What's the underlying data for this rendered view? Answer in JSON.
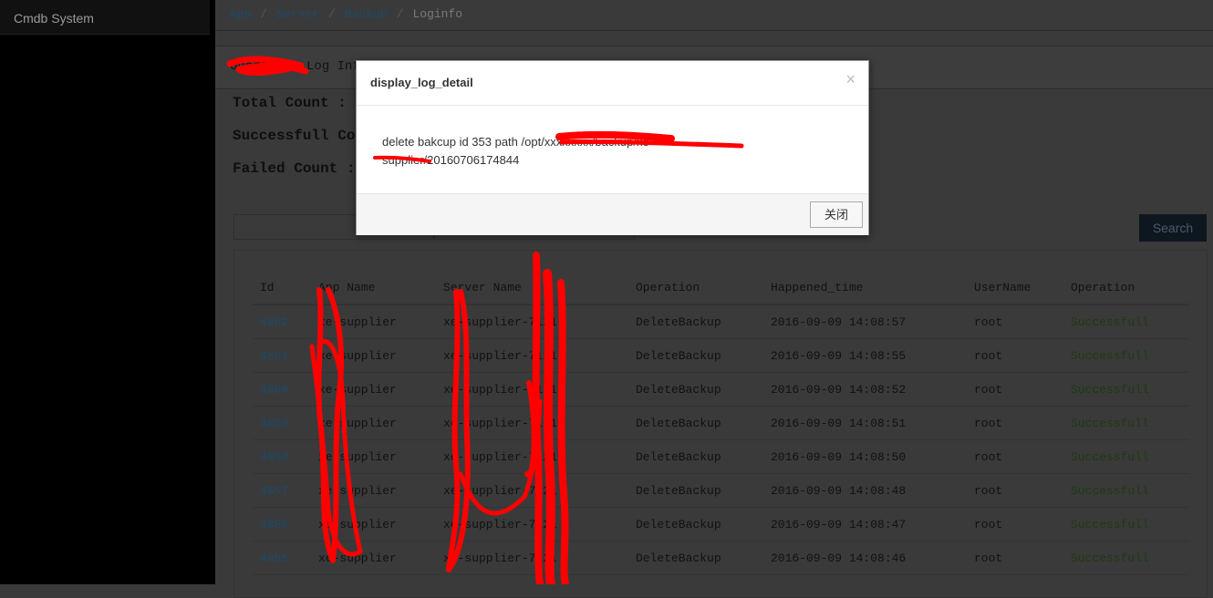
{
  "sidebar": {
    "brand": "Cmdb System"
  },
  "breadcrumb": {
    "items": [
      "App",
      "Server",
      "Backup"
    ],
    "active": "Loginfo"
  },
  "panel": {
    "title": "Operation Log Info"
  },
  "stats": {
    "total_label": "Total Count :",
    "success_label": "Successfull Count :",
    "failed_label": "Failed Count :"
  },
  "search": {
    "button_label": "Search"
  },
  "table": {
    "headers": [
      "Id",
      "App Name",
      "Server Name",
      "Operation",
      "Happened_time",
      "UserName",
      "Operation"
    ],
    "rows": [
      {
        "id": "4862",
        "app": "xe-supplier",
        "server": "xe-supplier-7121",
        "operation": "DeleteBackup",
        "time": "2016-09-09 14:08:57",
        "user": "root",
        "status": "Successfull"
      },
      {
        "id": "4861",
        "app": "xe-supplier",
        "server": "xe-supplier-7121",
        "operation": "DeleteBackup",
        "time": "2016-09-09 14:08:55",
        "user": "root",
        "status": "Successfull"
      },
      {
        "id": "4860",
        "app": "xe-supplier",
        "server": "xe-supplier-7121",
        "operation": "DeleteBackup",
        "time": "2016-09-09 14:08:52",
        "user": "root",
        "status": "Successfull"
      },
      {
        "id": "4859",
        "app": "xe-supplier",
        "server": "xe-supplier-7121",
        "operation": "DeleteBackup",
        "time": "2016-09-09 14:08:51",
        "user": "root",
        "status": "Successfull"
      },
      {
        "id": "4858",
        "app": "xe-supplier",
        "server": "xe-supplier-7121",
        "operation": "DeleteBackup",
        "time": "2016-09-09 14:08:50",
        "user": "root",
        "status": "Successfull"
      },
      {
        "id": "4857",
        "app": "xe-supplier",
        "server": "xe-supplier-7121",
        "operation": "DeleteBackup",
        "time": "2016-09-09 14:08:48",
        "user": "root",
        "status": "Successfull"
      },
      {
        "id": "4856",
        "app": "xe-supplier",
        "server": "xe-supplier-7121",
        "operation": "DeleteBackup",
        "time": "2016-09-09 14:08:47",
        "user": "root",
        "status": "Successfull"
      },
      {
        "id": "4855",
        "app": "xe-supplier",
        "server": "xe-supplier-7121",
        "operation": "DeleteBackup",
        "time": "2016-09-09 14:08:46",
        "user": "root",
        "status": "Successfull"
      }
    ]
  },
  "modal": {
    "title": "display_log_detail",
    "close_glyph": "×",
    "text": "delete bakcup id 353 path /opt/xxxxxxxx/backup/xe-supplier/20160706174844",
    "button_label": "关闭"
  },
  "colors": {
    "link": "#1c4a6a",
    "success": "#1e3a12",
    "redaction": "#ff0000"
  }
}
